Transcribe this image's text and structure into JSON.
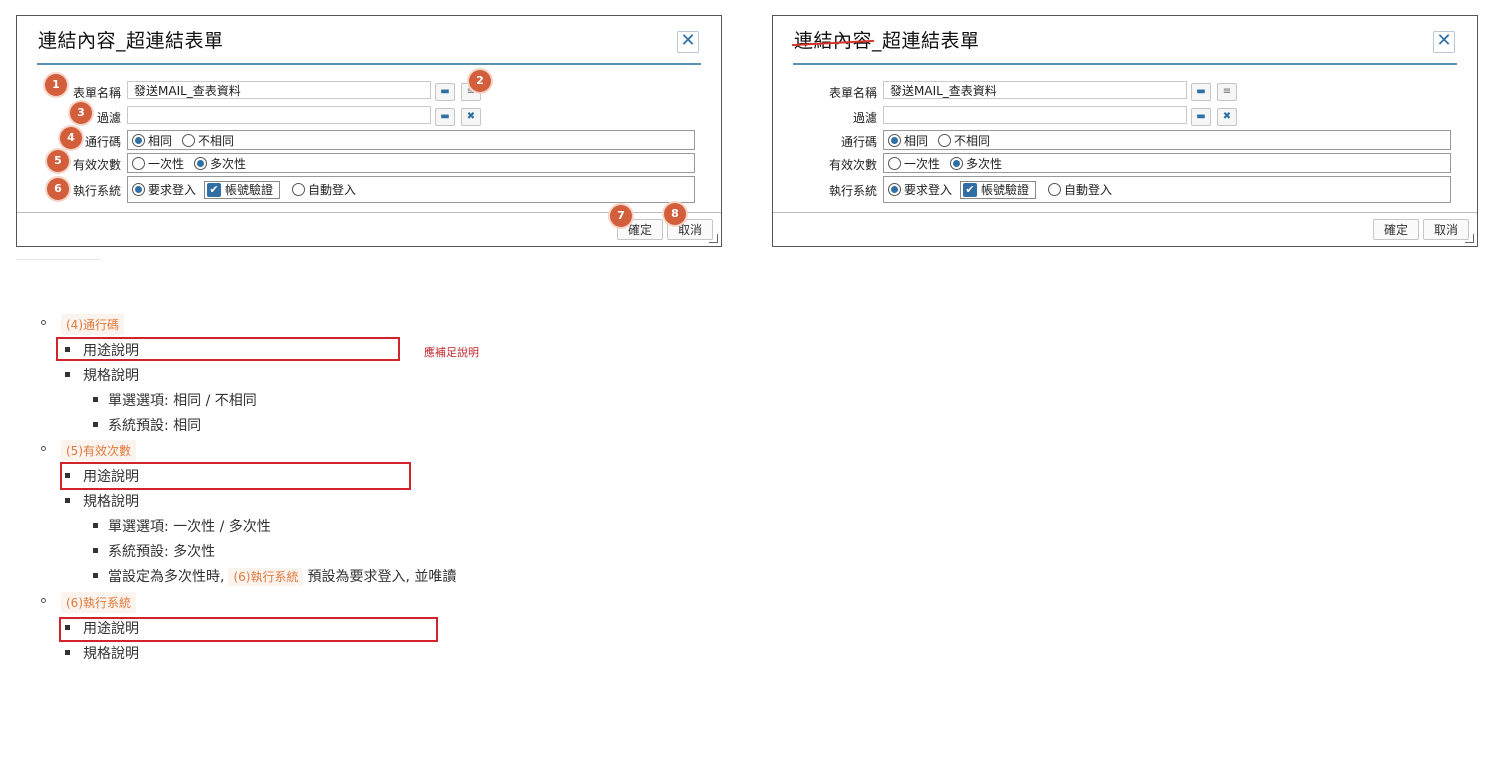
{
  "dialog": {
    "title_part1": "連結內容",
    "title_part2": "_超連結表單",
    "form_name_label": "表單名稱",
    "form_name_value": "發送MAIL_查表資料",
    "filter_label": "過濾",
    "filter_value": "",
    "passcode_label": "通行碼",
    "passcode_options": [
      "相同",
      "不相同"
    ],
    "passcode_selected": "相同",
    "valid_count_label": "有效次數",
    "valid_count_options": [
      "一次性",
      "多次性"
    ],
    "valid_count_selected": "多次性",
    "exec_system_label": "執行系統",
    "exec_option_login": "要求登入",
    "exec_option_account_verify": "帳號驗證",
    "exec_option_auto_login": "自動登入",
    "ok_label": "確定",
    "cancel_label": "取消"
  },
  "badges": [
    "1",
    "2",
    "3",
    "4",
    "5",
    "6",
    "7",
    "8"
  ],
  "notes": {
    "s4_tag": "(4)通行碼",
    "s4_purpose": "用途說明",
    "s4_spec": "規格說明",
    "s4_options": "單選選項: 相同 / 不相同",
    "s4_default": "系統預設: 相同",
    "s5_tag": "(5)有效次數",
    "s5_purpose": "用途說明",
    "s5_spec": "規格說明",
    "s5_options": "單選選項: 一次性 / 多次性",
    "s5_default": "系統預設: 多次性",
    "s5_when_prefix": "當設定為多次性時,",
    "s5_when_tag": "(6)執行系統",
    "s5_when_suffix": "預設為要求登入, 並唯讀",
    "s6_tag": "(6)執行系統",
    "s6_purpose": "用途說明",
    "s6_spec": "規格說明",
    "review_comment": "應補足說明"
  },
  "colors": {
    "accent": "#2f6fa3",
    "badge": "#d25e3c",
    "tag_text": "#e07a3c",
    "review_red": "#d0232a"
  }
}
